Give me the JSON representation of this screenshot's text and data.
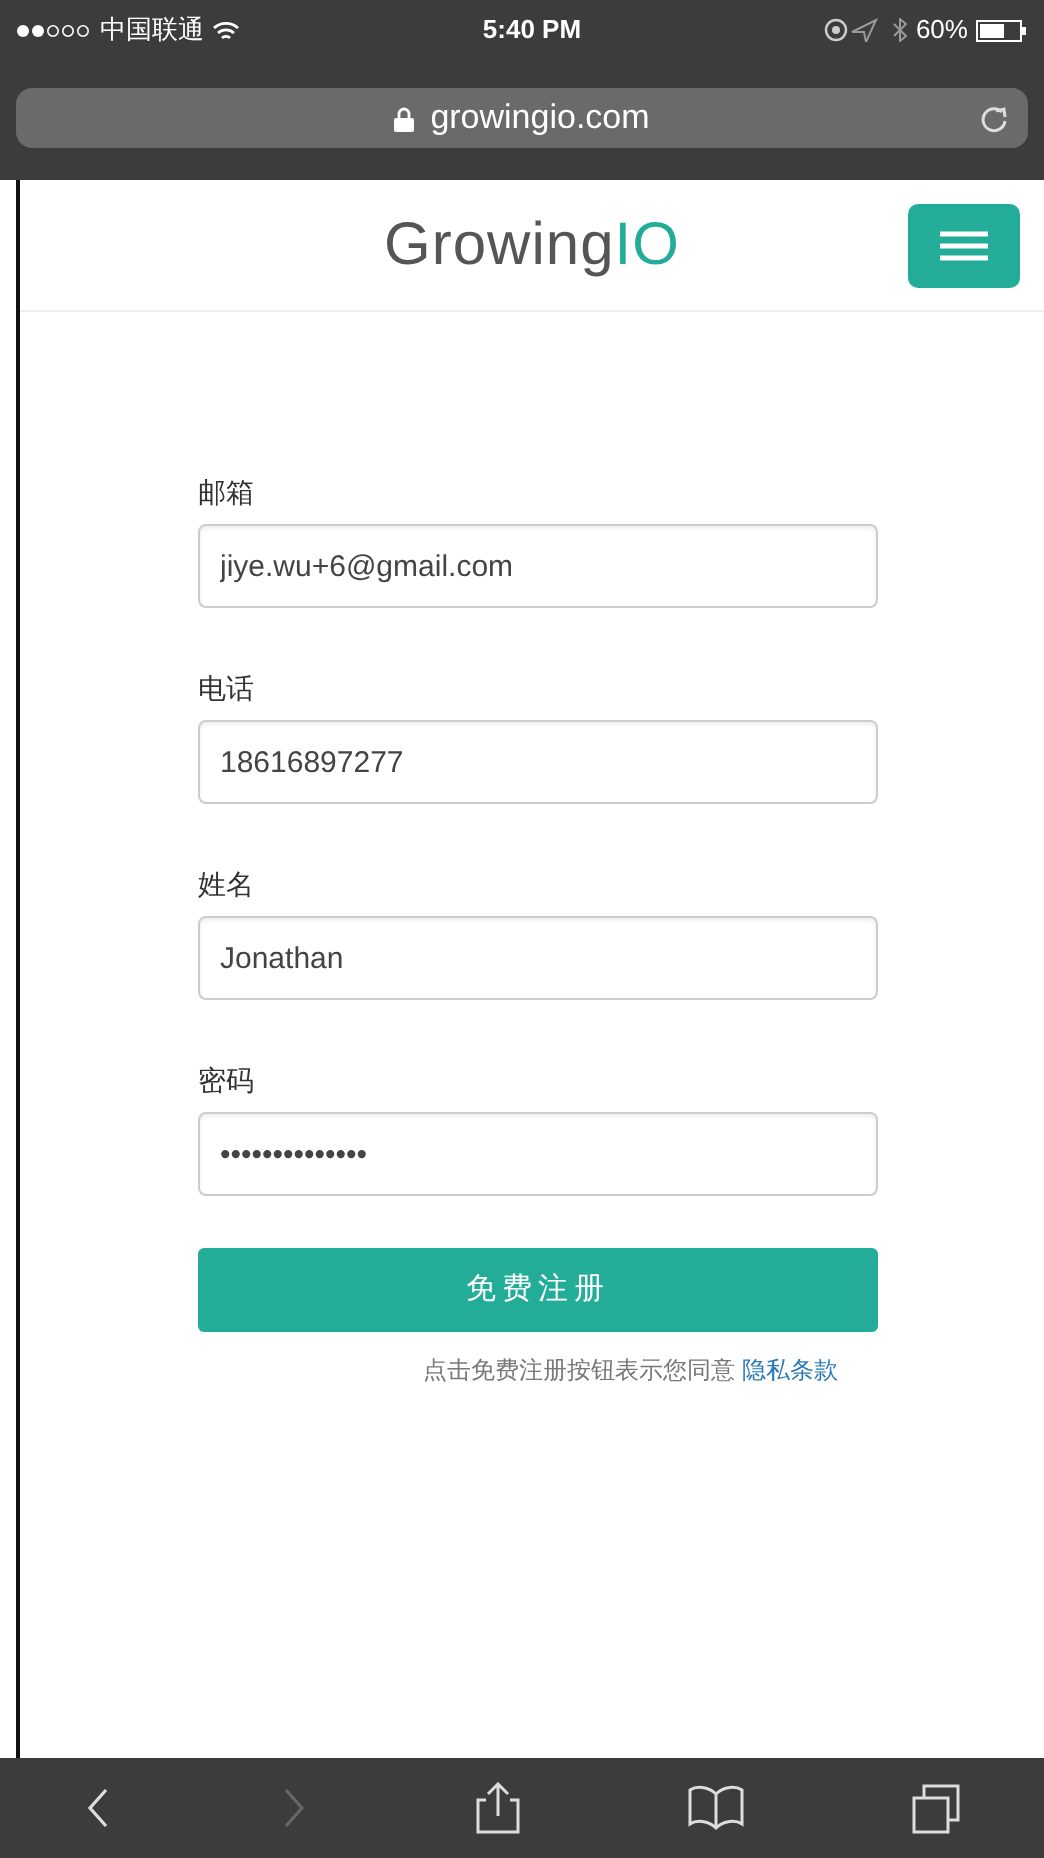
{
  "status_bar": {
    "carrier": "中国联通",
    "time": "5:40 PM",
    "battery": "60%"
  },
  "address_bar": {
    "url": "growingio.com"
  },
  "header": {
    "logo": "Growing",
    "logo_accent": "IO"
  },
  "form": {
    "fields": [
      {
        "label": "邮箱",
        "value": "jiye.wu+6@gmail.com"
      },
      {
        "label": "电话",
        "value": "18616897277"
      },
      {
        "label": "姓名",
        "value": "Jonathan"
      },
      {
        "label": "密码",
        "value": "••••••••••••••"
      }
    ],
    "submit": "免费注册",
    "note": "点击免费注册按钮表示您同意",
    "note_link": "隐私条款"
  },
  "toolbar": [
    {
      "kind": "back",
      "disabled": false
    },
    {
      "kind": "forward",
      "disabled": true
    },
    {
      "kind": "share",
      "disabled": false
    },
    {
      "kind": "bookmarks",
      "disabled": false
    },
    {
      "kind": "tabs",
      "disabled": false
    }
  ]
}
